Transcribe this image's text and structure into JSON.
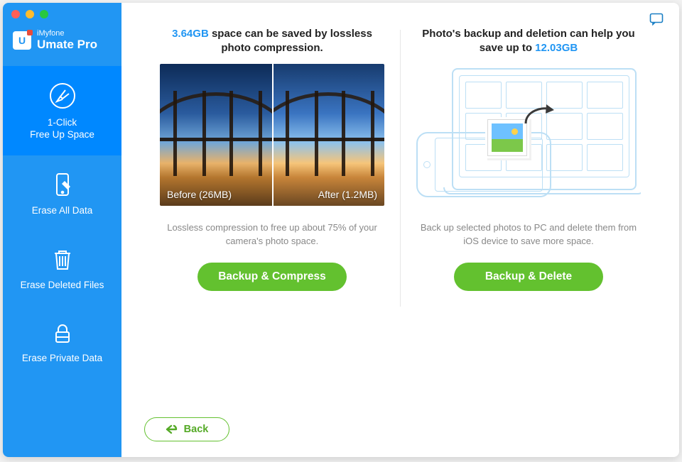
{
  "brand": {
    "top": "iMyfone",
    "main": "Umate Pro"
  },
  "sidebar": {
    "items": [
      {
        "label": "1-Click\nFree Up Space",
        "icon": "broom"
      },
      {
        "label": "Erase All Data",
        "icon": "phone-erase"
      },
      {
        "label": "Erase Deleted Files",
        "icon": "trash"
      },
      {
        "label": "Erase Private Data",
        "icon": "lock"
      }
    ]
  },
  "left": {
    "headline_size": "3.64GB",
    "headline_rest": " space can be saved by lossless photo compression.",
    "before_label": "Before (26MB)",
    "after_label": "After (1.2MB)",
    "subtext": "Lossless compression to free up about 75% of your camera's photo space.",
    "cta": "Backup & Compress"
  },
  "right": {
    "headline_pre": "Photo's backup and deletion can help you save up to ",
    "headline_size": "12.03GB",
    "subtext": "Back up selected photos to PC and delete them from iOS device to save more space.",
    "cta": "Backup & Delete"
  },
  "back_label": "Back",
  "colors": {
    "accent": "#2196f3",
    "cta": "#63c12f"
  }
}
